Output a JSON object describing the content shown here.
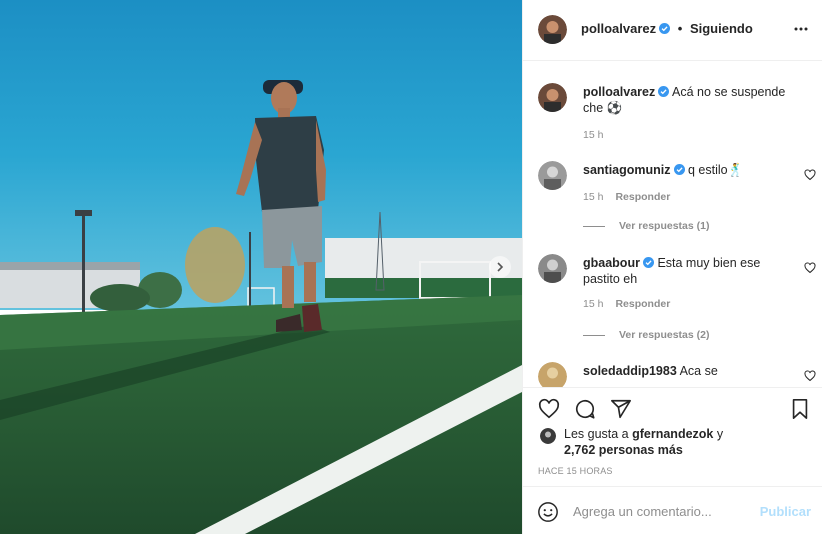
{
  "post": {
    "username": "polloalvarez",
    "dot": "•",
    "follow_status": "Siguiendo",
    "caption": "Acá no se suspende che ⚽",
    "caption_time": "15 h"
  },
  "comments": [
    {
      "user": "santiagomuniz",
      "text": "q estilo🕺",
      "time": "15 h",
      "reply_label": "Responder",
      "view_replies": "Ver respuestas (1)",
      "verified": true
    },
    {
      "user": "gbaabour",
      "text": "Esta muy bien ese pastito eh",
      "time": "15 h",
      "reply_label": "Responder",
      "view_replies": "Ver respuestas (2)",
      "verified": true
    },
    {
      "user": "soledaddip1983",
      "text": "Aca se",
      "verified": false
    }
  ],
  "likes": {
    "prefix": "Les gusta a ",
    "user": "gfernandezok",
    "connector": " y",
    "count_text": "2,762 personas más"
  },
  "time_ago": "HACE 15 HORAS",
  "comment_box": {
    "placeholder": "Agrega un comentario...",
    "publish_label": "Publicar"
  },
  "colors": {
    "verified": "#3897f0",
    "publish_disabled": "#b2dffc",
    "secondary_text": "#8e8e8e"
  },
  "icons": [
    "verified-badge-icon",
    "more-options-icon",
    "heart-icon",
    "comment-icon",
    "share-icon",
    "bookmark-icon",
    "emoji-icon",
    "chevron-right-icon"
  ]
}
